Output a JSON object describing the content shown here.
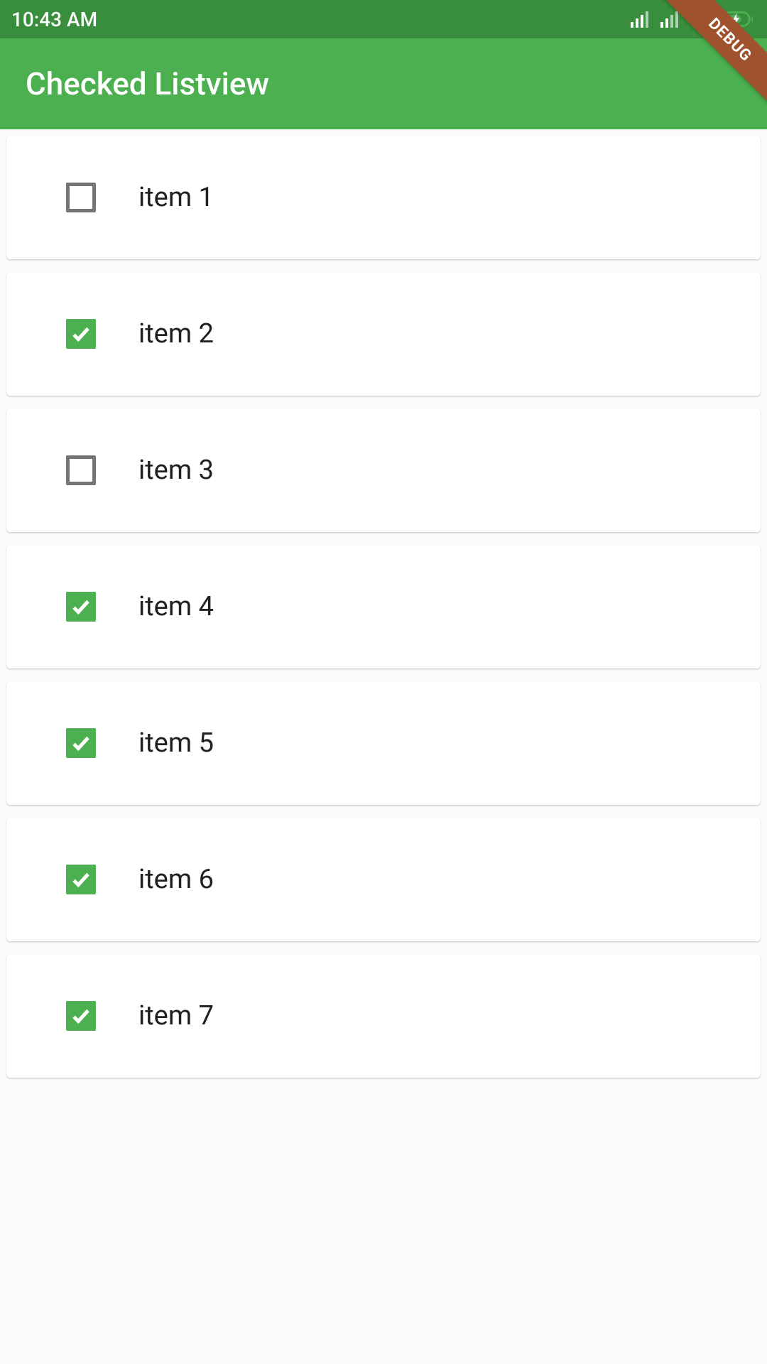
{
  "status_bar": {
    "time": "10:43 AM"
  },
  "app_bar": {
    "title": "Checked Listview"
  },
  "debug_banner": {
    "label": "DEBUG"
  },
  "list": {
    "items": [
      {
        "label": "item 1",
        "checked": false
      },
      {
        "label": "item 2",
        "checked": true
      },
      {
        "label": "item 3",
        "checked": false
      },
      {
        "label": "item 4",
        "checked": true
      },
      {
        "label": "item 5",
        "checked": true
      },
      {
        "label": "item 6",
        "checked": true
      },
      {
        "label": "item 7",
        "checked": true
      }
    ]
  },
  "colors": {
    "primary": "#4caf50",
    "primary_dark": "#388e3c",
    "checkbox_unchecked_border": "#757575"
  }
}
